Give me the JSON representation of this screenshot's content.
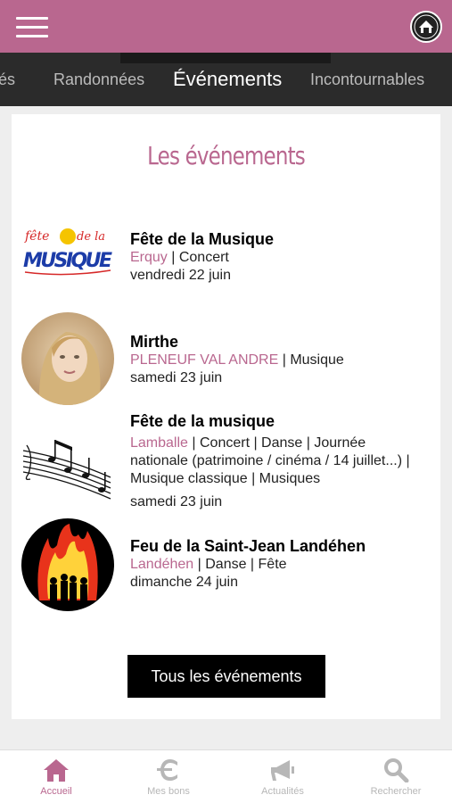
{
  "header": {
    "menu_icon": "hamburger-icon",
    "logo_icon": "house-badge-icon"
  },
  "tabs": [
    {
      "label": "és"
    },
    {
      "label": "Randonnées"
    },
    {
      "label": "Événements",
      "active": true
    },
    {
      "label": "Incontournables"
    }
  ],
  "main": {
    "title": "Les événements",
    "events": [
      {
        "title": "Fête de la Musique",
        "location": "Erquy",
        "categories": " | Concert",
        "date": "vendredi 22 juin",
        "thumb": "fete-musique-logo",
        "logo_text": "fête de la MUSIQUE"
      },
      {
        "title": "Mirthe",
        "location": "PLENEUF VAL ANDRE",
        "categories": " | Musique",
        "date": "samedi 23 juin",
        "thumb": "portrait-photo"
      },
      {
        "title": "Fête de la musique",
        "location": "Lamballe",
        "categories": " | Concert | Danse | Journée nationale (patrimoine / cinéma / 14 juillet...) | Musique classique | Musiques",
        "date": "samedi 23 juin",
        "thumb": "music-notes-drawing"
      },
      {
        "title": "Feu de la Saint-Jean Landéhen",
        "location": "Landéhen",
        "categories": " | Danse | Fête",
        "date": "dimanche 24 juin",
        "thumb": "bonfire-drawing"
      }
    ],
    "all_button": "Tous les événements"
  },
  "bottom_nav": [
    {
      "label": "Accueil",
      "icon": "home-icon",
      "active": true
    },
    {
      "label": "Mes bons",
      "icon": "euro-icon"
    },
    {
      "label": "Actualités",
      "icon": "megaphone-icon"
    },
    {
      "label": "Rechercher",
      "icon": "search-icon"
    }
  ],
  "colors": {
    "brand": "#b9678f",
    "tabbar": "#2b2b2b",
    "nav_inactive": "#b7b7b7"
  }
}
